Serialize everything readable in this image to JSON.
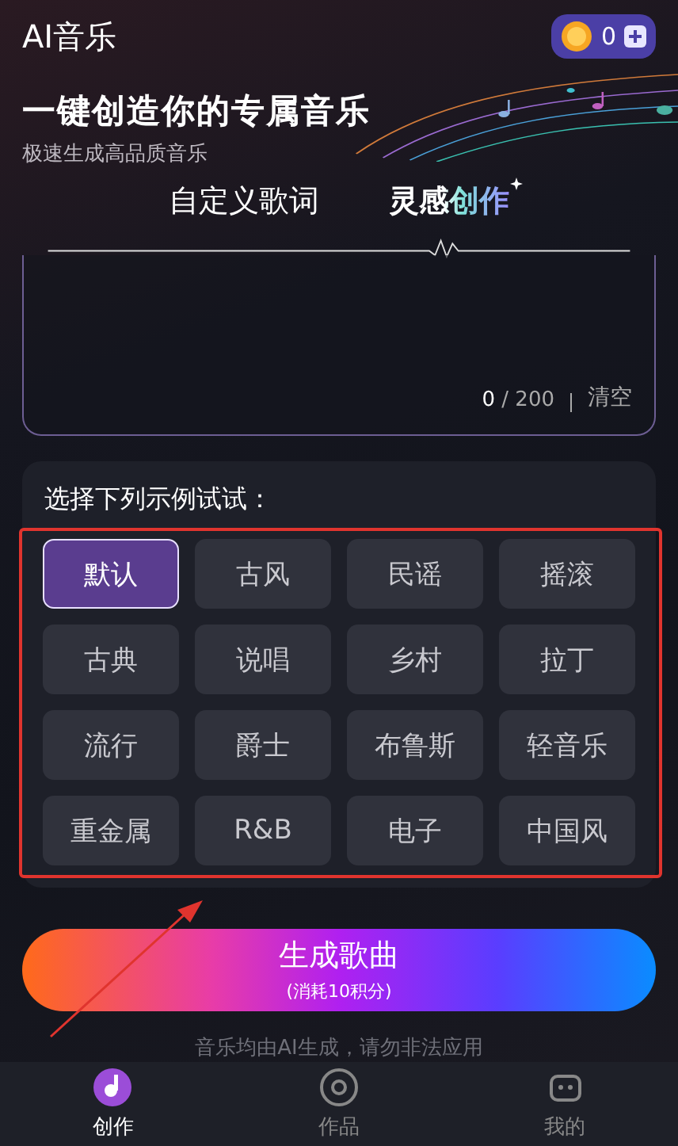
{
  "header": {
    "title": "AI音乐",
    "coins": "0",
    "headline": "一键创造你的专属音乐",
    "subtitle": "极速生成高品质音乐"
  },
  "tabs": [
    {
      "label": "自定义歌词",
      "selected": false
    },
    {
      "label": "灵感创作",
      "selected": true
    }
  ],
  "lyrics_input": {
    "counter_current": "0",
    "counter_total": "/ 200",
    "clear": "清空"
  },
  "examples": {
    "title": "选择下列示例试试：",
    "options": [
      {
        "label": "默认",
        "selected": true
      },
      {
        "label": "古风",
        "selected": false
      },
      {
        "label": "民谣",
        "selected": false
      },
      {
        "label": "摇滚",
        "selected": false
      },
      {
        "label": "古典",
        "selected": false
      },
      {
        "label": "说唱",
        "selected": false
      },
      {
        "label": "乡村",
        "selected": false
      },
      {
        "label": "拉丁",
        "selected": false
      },
      {
        "label": "流行",
        "selected": false
      },
      {
        "label": "爵士",
        "selected": false
      },
      {
        "label": "布鲁斯",
        "selected": false
      },
      {
        "label": "轻音乐",
        "selected": false
      },
      {
        "label": "重金属",
        "selected": false
      },
      {
        "label": "R&B",
        "selected": false
      },
      {
        "label": "电子",
        "selected": false
      },
      {
        "label": "中国风",
        "selected": false
      }
    ]
  },
  "generate_button": {
    "label": "生成歌曲",
    "cost": "(消耗10积分)"
  },
  "notice": "音乐均由AI生成，请勿非法应用",
  "nav": [
    {
      "label": "创作",
      "selected": true,
      "kind": "create"
    },
    {
      "label": "作品",
      "selected": false,
      "kind": "works"
    },
    {
      "label": "我的",
      "selected": false,
      "kind": "me"
    }
  ]
}
